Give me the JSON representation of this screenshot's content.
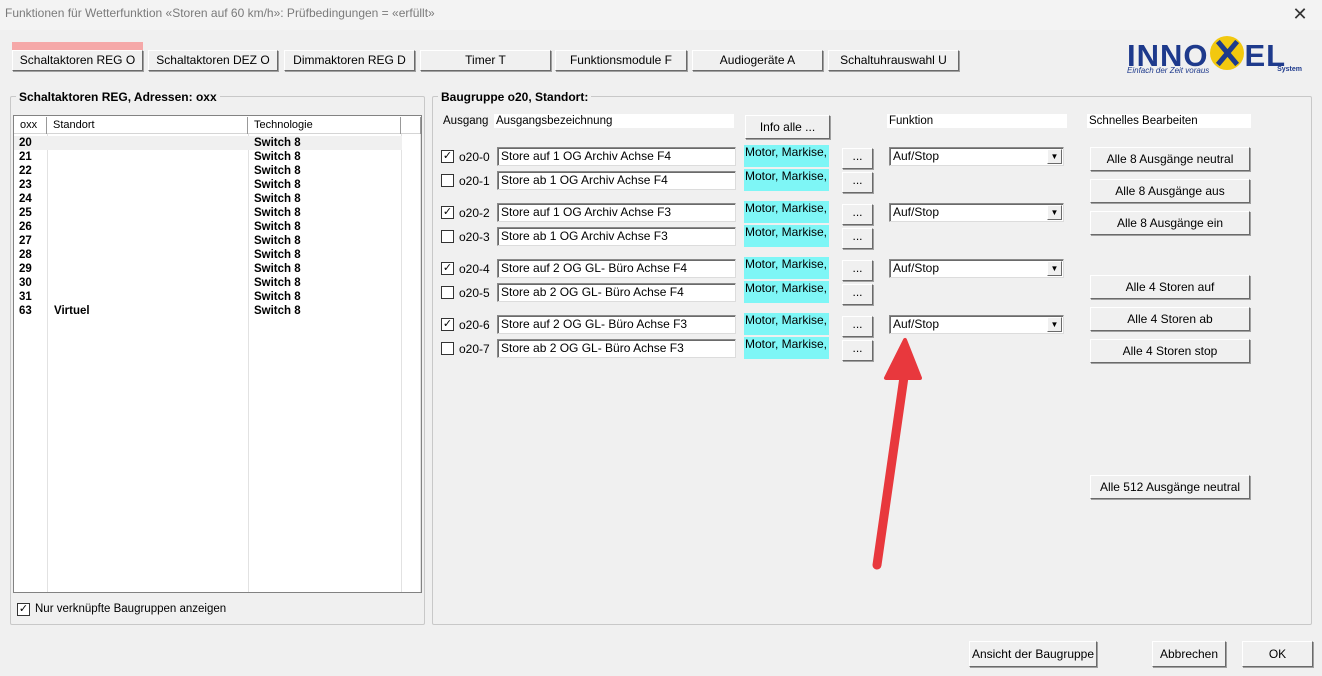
{
  "window": {
    "title": "Funktionen für Wetterfunktion «Storen auf 60 km/h»: Prüfbedingungen = «erfüllt»",
    "close_symbol": "✕"
  },
  "tabs": [
    {
      "label": "Schaltaktoren REG O",
      "active": true
    },
    {
      "label": "Schaltaktoren DEZ O",
      "active": false
    },
    {
      "label": "Dimmaktoren REG D",
      "active": false
    },
    {
      "label": "Timer T",
      "active": false
    },
    {
      "label": "Funktionsmodule F",
      "active": false
    },
    {
      "label": "Audiogeräte A",
      "active": false
    },
    {
      "label": "Schaltuhrauswahl U",
      "active": false
    }
  ],
  "logo": {
    "left_text": "INNO",
    "right_text": "EL",
    "tagline": "Einfach der Zeit voraus",
    "system": "System",
    "colors": {
      "blue": "#1e3a8c",
      "yellow": "#f2c80f"
    }
  },
  "left_panel": {
    "title": "Schaltaktoren REG, Adressen: oxx",
    "columns": [
      "oxx",
      "Standort",
      "Technologie"
    ],
    "rows": [
      {
        "addr": "20",
        "standort": "",
        "tech": "Switch 8",
        "selected": true
      },
      {
        "addr": "21",
        "standort": "",
        "tech": "Switch 8"
      },
      {
        "addr": "22",
        "standort": "",
        "tech": "Switch 8"
      },
      {
        "addr": "23",
        "standort": "",
        "tech": "Switch 8"
      },
      {
        "addr": "24",
        "standort": "",
        "tech": "Switch 8"
      },
      {
        "addr": "25",
        "standort": "",
        "tech": "Switch 8"
      },
      {
        "addr": "26",
        "standort": "",
        "tech": "Switch 8"
      },
      {
        "addr": "27",
        "standort": "",
        "tech": "Switch 8"
      },
      {
        "addr": "28",
        "standort": "",
        "tech": "Switch 8"
      },
      {
        "addr": "29",
        "standort": "",
        "tech": "Switch 8"
      },
      {
        "addr": "30",
        "standort": "",
        "tech": "Switch 8"
      },
      {
        "addr": "31",
        "standort": "",
        "tech": "Switch 8"
      },
      {
        "addr": "63",
        "standort": "Virtuel",
        "tech": "Switch 8"
      }
    ],
    "only_linked_label": "Nur verknüpfte Baugruppen anzeigen",
    "only_linked_checked": true
  },
  "right_panel": {
    "title": "Baugruppe o20, Standort:",
    "col_ausgang": "Ausgang",
    "col_bezeichnung": "Ausgangsbezeichnung",
    "info_button": "Info alle ...",
    "col_funktion": "Funktion",
    "col_schnell": "Schnelles Bearbeiten",
    "outputs": [
      {
        "id": "o20-0",
        "checked": true,
        "name": "Store auf 1 OG Archiv Achse F4",
        "type": "Motor, Markise, R",
        "funktion": "Auf/Stop"
      },
      {
        "id": "o20-1",
        "checked": false,
        "name": "Store ab 1 OG Archiv Achse F4",
        "type": "Motor, Markise, R",
        "funktion": ""
      },
      {
        "id": "o20-2",
        "checked": true,
        "name": "Store auf 1 OG Archiv Achse F3",
        "type": "Motor, Markise, R",
        "funktion": "Auf/Stop"
      },
      {
        "id": "o20-3",
        "checked": false,
        "name": "Store ab 1 OG Archiv Achse F3",
        "type": "Motor, Markise, R",
        "funktion": ""
      },
      {
        "id": "o20-4",
        "checked": true,
        "name": "Store auf 2 OG GL- Büro Achse F4",
        "type": "Motor, Markise, R",
        "funktion": "Auf/Stop"
      },
      {
        "id": "o20-5",
        "checked": false,
        "name": "Store ab 2 OG GL- Büro Achse F4",
        "type": "Motor, Markise, R",
        "funktion": ""
      },
      {
        "id": "o20-6",
        "checked": true,
        "name": "Store auf 2 OG GL- Büro Achse F3",
        "type": "Motor, Markise, R",
        "funktion": "Auf/Stop"
      },
      {
        "id": "o20-7",
        "checked": false,
        "name": "Store ab 2 OG GL- Büro Achse F3",
        "type": "Motor, Markise, R",
        "funktion": ""
      }
    ],
    "ellipsis": "...",
    "quick_buttons": [
      "Alle 8 Ausgänge neutral",
      "Alle 8 Ausgänge aus",
      "Alle 8 Ausgänge ein",
      "Alle 4 Storen auf",
      "Alle 4 Storen ab",
      "Alle 4 Storen stop",
      "Alle 512 Ausgänge neutral"
    ],
    "cyan_color": "#7ef6f6"
  },
  "footer": {
    "view_button": "Ansicht der Baugruppe",
    "cancel_button": "Abbrechen",
    "ok_button": "OK"
  },
  "annotation": {
    "arrow_color": "#e8383d"
  }
}
